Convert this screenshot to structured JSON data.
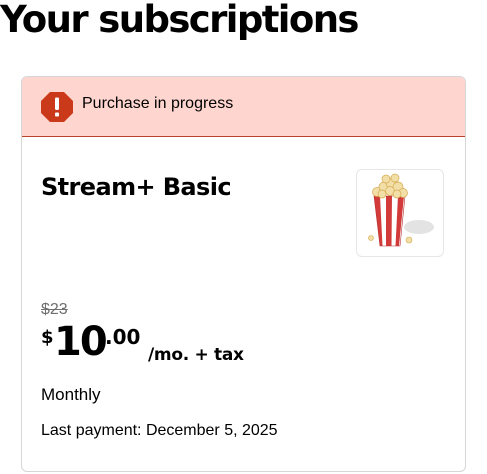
{
  "page": {
    "title": "Your subscriptions"
  },
  "alert": {
    "icon": "warning-octagon-icon",
    "text": "Purchase in progress",
    "color": "#c9391a",
    "background": "#ffd6cf"
  },
  "subscription": {
    "name": "Stream+ Basic",
    "image": "popcorn-icon",
    "original_price": "$23",
    "price": {
      "currency": "$",
      "dollars": "10",
      "cents": ".00",
      "period": "/mo. + tax"
    },
    "billing_cycle": "Monthly",
    "last_payment": "Last payment: December 5, 2025"
  }
}
